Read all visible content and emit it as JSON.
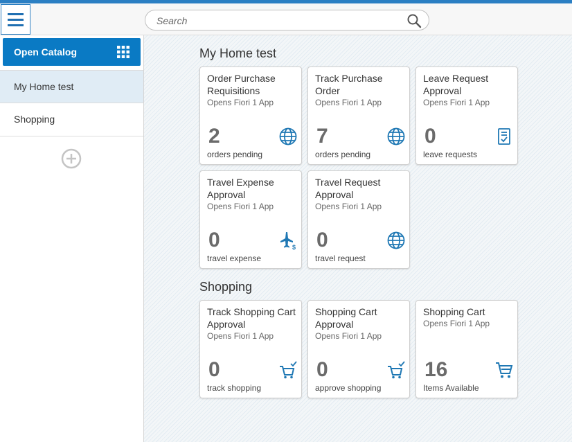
{
  "header": {
    "menu_icon": "hamburger-icon",
    "search": {
      "placeholder": "Search",
      "icon": "search-icon"
    }
  },
  "sidebar": {
    "open_catalog_label": "Open Catalog",
    "open_catalog_icon": "grid-icon",
    "items": [
      {
        "label": "My Home test",
        "selected": true
      },
      {
        "label": "Shopping",
        "selected": false
      }
    ],
    "add_group_icon": "add-circle-icon"
  },
  "groups": [
    {
      "title": "My Home test",
      "tiles": [
        {
          "title": "Order Purchase Requisitions",
          "subtitle": "Opens Fiori 1 App",
          "number": "2",
          "info": "orders pending",
          "icon": "globe-icon"
        },
        {
          "title": "Track Purchase Order",
          "subtitle": "Opens Fiori 1 App",
          "number": "7",
          "info": "orders pending",
          "icon": "globe-icon"
        },
        {
          "title": "Leave Request Approval",
          "subtitle": "Opens Fiori 1 App",
          "number": "0",
          "info": "leave requests",
          "icon": "request-document-icon"
        },
        {
          "title": "Travel Expense Approval",
          "subtitle": "Opens Fiori 1 App",
          "number": "0",
          "info": "travel expense",
          "icon": "travel-expense-icon"
        },
        {
          "title": "Travel Request Approval",
          "subtitle": "Opens Fiori 1 App",
          "number": "0",
          "info": "travel request",
          "icon": "globe-icon"
        }
      ]
    },
    {
      "title": "Shopping",
      "tiles": [
        {
          "title": "Track Shopping Cart Approval",
          "subtitle": "Opens Fiori 1 App",
          "number": "0",
          "info": "track shopping",
          "icon": "cart-approved-icon"
        },
        {
          "title": "Shopping Cart Approval",
          "subtitle": "Opens Fiori 1 App",
          "number": "0",
          "info": "approve shopping",
          "icon": "cart-approved-icon"
        },
        {
          "title": "Shopping Cart",
          "subtitle": "Opens Fiori 1 App",
          "number": "16",
          "info": "Items Available",
          "icon": "cart-icon"
        }
      ]
    }
  ],
  "colors": {
    "accent": "#0a7ac4",
    "icon": "#1f78b4",
    "selected_bg": "#e0ecf5"
  }
}
